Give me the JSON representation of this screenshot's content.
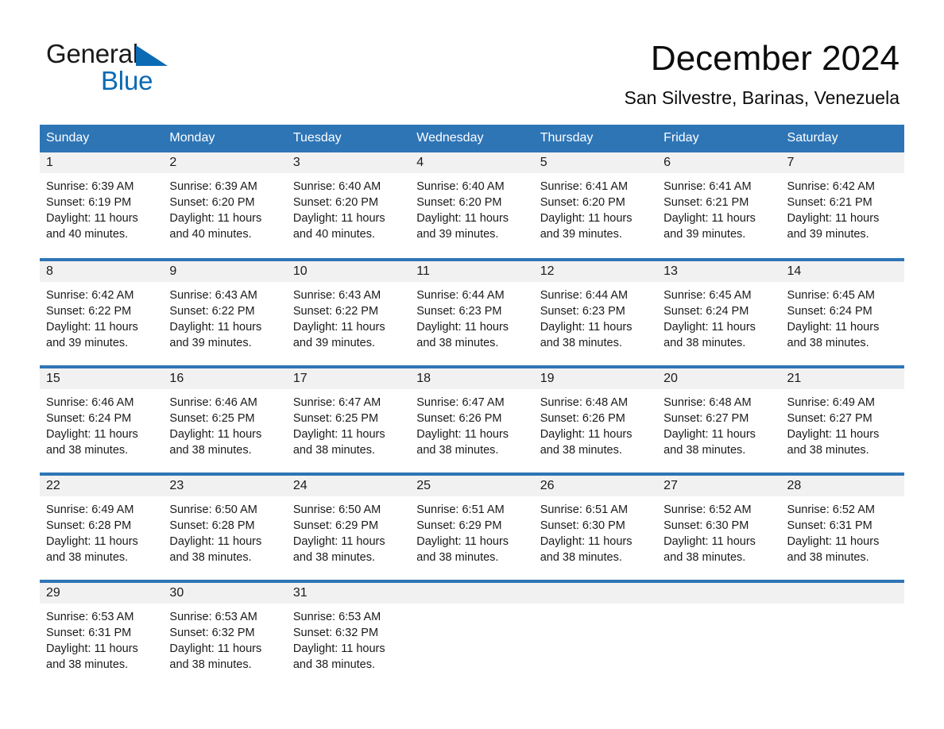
{
  "brand": {
    "name_part1": "General",
    "name_part2": "Blue",
    "logo_icon": "blue-triangle-icon",
    "color_primary": "#0a6ab4",
    "color_header": "#2e75b6"
  },
  "header": {
    "title": "December 2024",
    "subtitle": "San Silvestre, Barinas, Venezuela"
  },
  "calendar": {
    "weekday_headers": [
      "Sunday",
      "Monday",
      "Tuesday",
      "Wednesday",
      "Thursday",
      "Friday",
      "Saturday"
    ],
    "weeks": [
      [
        {
          "day": "1",
          "sunrise": "Sunrise: 6:39 AM",
          "sunset": "Sunset: 6:19 PM",
          "daylight": "Daylight: 11 hours and 40 minutes."
        },
        {
          "day": "2",
          "sunrise": "Sunrise: 6:39 AM",
          "sunset": "Sunset: 6:20 PM",
          "daylight": "Daylight: 11 hours and 40 minutes."
        },
        {
          "day": "3",
          "sunrise": "Sunrise: 6:40 AM",
          "sunset": "Sunset: 6:20 PM",
          "daylight": "Daylight: 11 hours and 40 minutes."
        },
        {
          "day": "4",
          "sunrise": "Sunrise: 6:40 AM",
          "sunset": "Sunset: 6:20 PM",
          "daylight": "Daylight: 11 hours and 39 minutes."
        },
        {
          "day": "5",
          "sunrise": "Sunrise: 6:41 AM",
          "sunset": "Sunset: 6:20 PM",
          "daylight": "Daylight: 11 hours and 39 minutes."
        },
        {
          "day": "6",
          "sunrise": "Sunrise: 6:41 AM",
          "sunset": "Sunset: 6:21 PM",
          "daylight": "Daylight: 11 hours and 39 minutes."
        },
        {
          "day": "7",
          "sunrise": "Sunrise: 6:42 AM",
          "sunset": "Sunset: 6:21 PM",
          "daylight": "Daylight: 11 hours and 39 minutes."
        }
      ],
      [
        {
          "day": "8",
          "sunrise": "Sunrise: 6:42 AM",
          "sunset": "Sunset: 6:22 PM",
          "daylight": "Daylight: 11 hours and 39 minutes."
        },
        {
          "day": "9",
          "sunrise": "Sunrise: 6:43 AM",
          "sunset": "Sunset: 6:22 PM",
          "daylight": "Daylight: 11 hours and 39 minutes."
        },
        {
          "day": "10",
          "sunrise": "Sunrise: 6:43 AM",
          "sunset": "Sunset: 6:22 PM",
          "daylight": "Daylight: 11 hours and 39 minutes."
        },
        {
          "day": "11",
          "sunrise": "Sunrise: 6:44 AM",
          "sunset": "Sunset: 6:23 PM",
          "daylight": "Daylight: 11 hours and 38 minutes."
        },
        {
          "day": "12",
          "sunrise": "Sunrise: 6:44 AM",
          "sunset": "Sunset: 6:23 PM",
          "daylight": "Daylight: 11 hours and 38 minutes."
        },
        {
          "day": "13",
          "sunrise": "Sunrise: 6:45 AM",
          "sunset": "Sunset: 6:24 PM",
          "daylight": "Daylight: 11 hours and 38 minutes."
        },
        {
          "day": "14",
          "sunrise": "Sunrise: 6:45 AM",
          "sunset": "Sunset: 6:24 PM",
          "daylight": "Daylight: 11 hours and 38 minutes."
        }
      ],
      [
        {
          "day": "15",
          "sunrise": "Sunrise: 6:46 AM",
          "sunset": "Sunset: 6:24 PM",
          "daylight": "Daylight: 11 hours and 38 minutes."
        },
        {
          "day": "16",
          "sunrise": "Sunrise: 6:46 AM",
          "sunset": "Sunset: 6:25 PM",
          "daylight": "Daylight: 11 hours and 38 minutes."
        },
        {
          "day": "17",
          "sunrise": "Sunrise: 6:47 AM",
          "sunset": "Sunset: 6:25 PM",
          "daylight": "Daylight: 11 hours and 38 minutes."
        },
        {
          "day": "18",
          "sunrise": "Sunrise: 6:47 AM",
          "sunset": "Sunset: 6:26 PM",
          "daylight": "Daylight: 11 hours and 38 minutes."
        },
        {
          "day": "19",
          "sunrise": "Sunrise: 6:48 AM",
          "sunset": "Sunset: 6:26 PM",
          "daylight": "Daylight: 11 hours and 38 minutes."
        },
        {
          "day": "20",
          "sunrise": "Sunrise: 6:48 AM",
          "sunset": "Sunset: 6:27 PM",
          "daylight": "Daylight: 11 hours and 38 minutes."
        },
        {
          "day": "21",
          "sunrise": "Sunrise: 6:49 AM",
          "sunset": "Sunset: 6:27 PM",
          "daylight": "Daylight: 11 hours and 38 minutes."
        }
      ],
      [
        {
          "day": "22",
          "sunrise": "Sunrise: 6:49 AM",
          "sunset": "Sunset: 6:28 PM",
          "daylight": "Daylight: 11 hours and 38 minutes."
        },
        {
          "day": "23",
          "sunrise": "Sunrise: 6:50 AM",
          "sunset": "Sunset: 6:28 PM",
          "daylight": "Daylight: 11 hours and 38 minutes."
        },
        {
          "day": "24",
          "sunrise": "Sunrise: 6:50 AM",
          "sunset": "Sunset: 6:29 PM",
          "daylight": "Daylight: 11 hours and 38 minutes."
        },
        {
          "day": "25",
          "sunrise": "Sunrise: 6:51 AM",
          "sunset": "Sunset: 6:29 PM",
          "daylight": "Daylight: 11 hours and 38 minutes."
        },
        {
          "day": "26",
          "sunrise": "Sunrise: 6:51 AM",
          "sunset": "Sunset: 6:30 PM",
          "daylight": "Daylight: 11 hours and 38 minutes."
        },
        {
          "day": "27",
          "sunrise": "Sunrise: 6:52 AM",
          "sunset": "Sunset: 6:30 PM",
          "daylight": "Daylight: 11 hours and 38 minutes."
        },
        {
          "day": "28",
          "sunrise": "Sunrise: 6:52 AM",
          "sunset": "Sunset: 6:31 PM",
          "daylight": "Daylight: 11 hours and 38 minutes."
        }
      ],
      [
        {
          "day": "29",
          "sunrise": "Sunrise: 6:53 AM",
          "sunset": "Sunset: 6:31 PM",
          "daylight": "Daylight: 11 hours and 38 minutes."
        },
        {
          "day": "30",
          "sunrise": "Sunrise: 6:53 AM",
          "sunset": "Sunset: 6:32 PM",
          "daylight": "Daylight: 11 hours and 38 minutes."
        },
        {
          "day": "31",
          "sunrise": "Sunrise: 6:53 AM",
          "sunset": "Sunset: 6:32 PM",
          "daylight": "Daylight: 11 hours and 38 minutes."
        },
        {
          "day": "",
          "sunrise": "",
          "sunset": "",
          "daylight": ""
        },
        {
          "day": "",
          "sunrise": "",
          "sunset": "",
          "daylight": ""
        },
        {
          "day": "",
          "sunrise": "",
          "sunset": "",
          "daylight": ""
        },
        {
          "day": "",
          "sunrise": "",
          "sunset": "",
          "daylight": ""
        }
      ]
    ]
  }
}
